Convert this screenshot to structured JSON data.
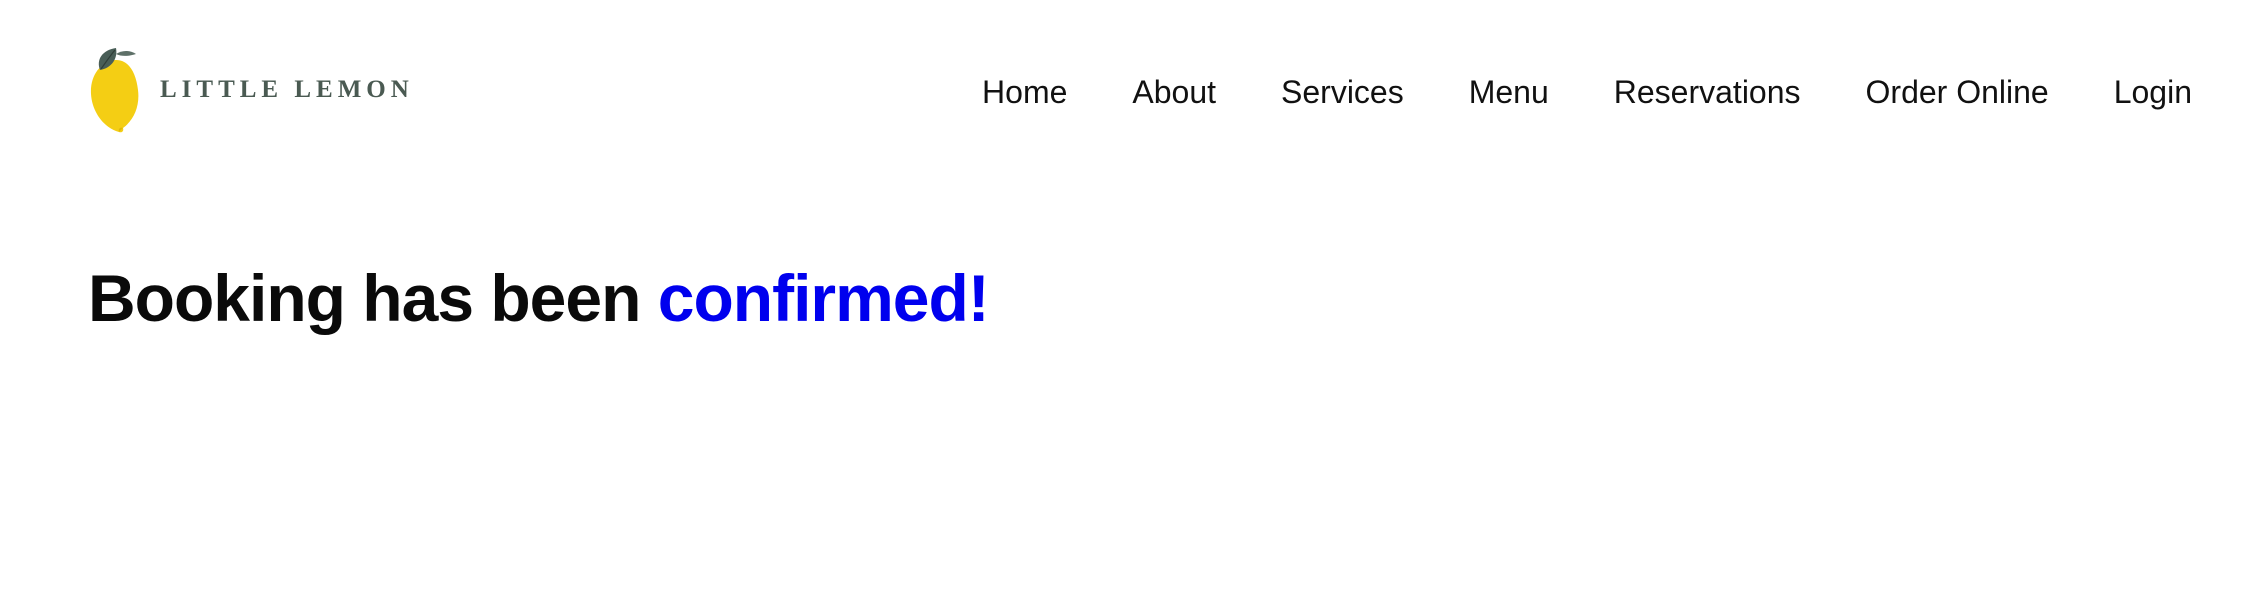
{
  "header": {
    "logo": {
      "icon": "lemon-icon",
      "text": "LITTLE LEMON"
    },
    "nav": [
      {
        "label": "Home"
      },
      {
        "label": "About"
      },
      {
        "label": "Services"
      },
      {
        "label": "Menu"
      },
      {
        "label": "Reservations"
      },
      {
        "label": "Order Online"
      },
      {
        "label": "Login"
      }
    ]
  },
  "main": {
    "heading_prefix": "Booking has been",
    "heading_accent": "confirmed!"
  },
  "colors": {
    "accent": "#0000ee",
    "text": "#111111",
    "logo_text": "#4a5a52",
    "lemon": "#f4ce14",
    "leaf": "#495e57"
  }
}
